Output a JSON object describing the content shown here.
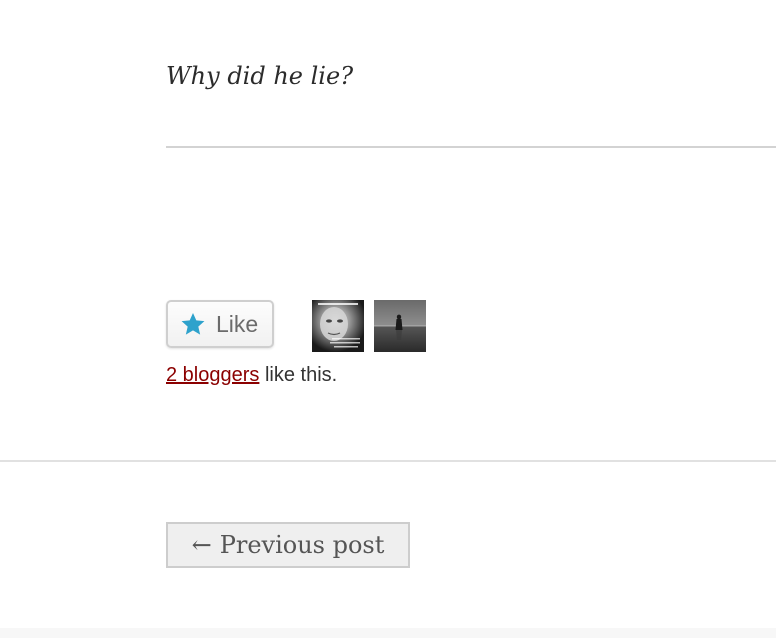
{
  "post": {
    "quote": "Why did he lie?"
  },
  "likes": {
    "button_label": "Like",
    "button_icon": "star-icon",
    "star_color": "#2ea2cc",
    "bloggers_link": "2 bloggers",
    "suffix_text": " like this.",
    "link_color": "#8b0000"
  },
  "navigation": {
    "arrow": "←",
    "previous_label": "Previous post"
  }
}
